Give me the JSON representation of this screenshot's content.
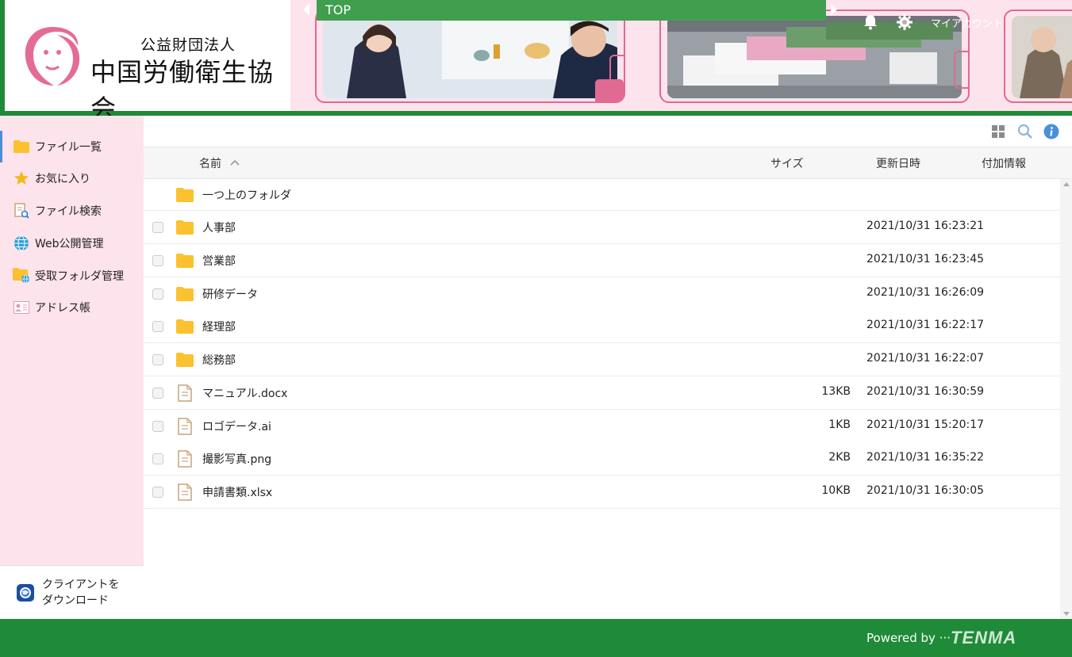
{
  "header": {
    "logo_sub": "公益財団法人",
    "logo_main": "中国労働衛生協会",
    "top_tab": "TOP",
    "account_label": "マイアカウント"
  },
  "sidebar": {
    "items": [
      {
        "label": "ファイル一覧",
        "icon": "folder-icon"
      },
      {
        "label": "お気に入り",
        "icon": "star-icon"
      },
      {
        "label": "ファイル検索",
        "icon": "file-search-icon"
      },
      {
        "label": "Web公開管理",
        "icon": "globe-icon"
      },
      {
        "label": "受取フォルダ管理",
        "icon": "folder-globe-icon"
      },
      {
        "label": "アドレス帳",
        "icon": "address-card-icon"
      }
    ],
    "client_download_line1": "クライアントを",
    "client_download_line2": "ダウンロード"
  },
  "columns": {
    "name": "名前",
    "size": "サイズ",
    "updated": "更新日時",
    "extra": "付加情報"
  },
  "parent_folder": "一つ上のフォルダ",
  "files": [
    {
      "type": "folder",
      "name": "人事部",
      "size": "",
      "date": "2021/10/31 16:23:21"
    },
    {
      "type": "folder",
      "name": "営業部",
      "size": "",
      "date": "2021/10/31 16:23:45"
    },
    {
      "type": "folder",
      "name": "研修データ",
      "size": "",
      "date": "2021/10/31 16:26:09"
    },
    {
      "type": "folder",
      "name": "経理部",
      "size": "",
      "date": "2021/10/31 16:22:17"
    },
    {
      "type": "folder",
      "name": "総務部",
      "size": "",
      "date": "2021/10/31 16:22:07"
    },
    {
      "type": "file",
      "name": "マニュアル.docx",
      "size": "13KB",
      "date": "2021/10/31 16:30:59"
    },
    {
      "type": "file",
      "name": "ロゴデータ.ai",
      "size": "1KB",
      "date": "2021/10/31 15:20:17"
    },
    {
      "type": "file",
      "name": "撮影写真.png",
      "size": "2KB",
      "date": "2021/10/31 16:35:22"
    },
    {
      "type": "file",
      "name": "申請書類.xlsx",
      "size": "10KB",
      "date": "2021/10/31 16:30:05"
    }
  ],
  "footer": {
    "powered_by": "Powered by ···",
    "brand": "TENMA"
  },
  "colors": {
    "green": "#1f8a38",
    "pink_bg": "#fde3ec",
    "pink_accent": "#e06a92",
    "folder": "#fbc12e",
    "info_blue": "#4a90d9"
  }
}
